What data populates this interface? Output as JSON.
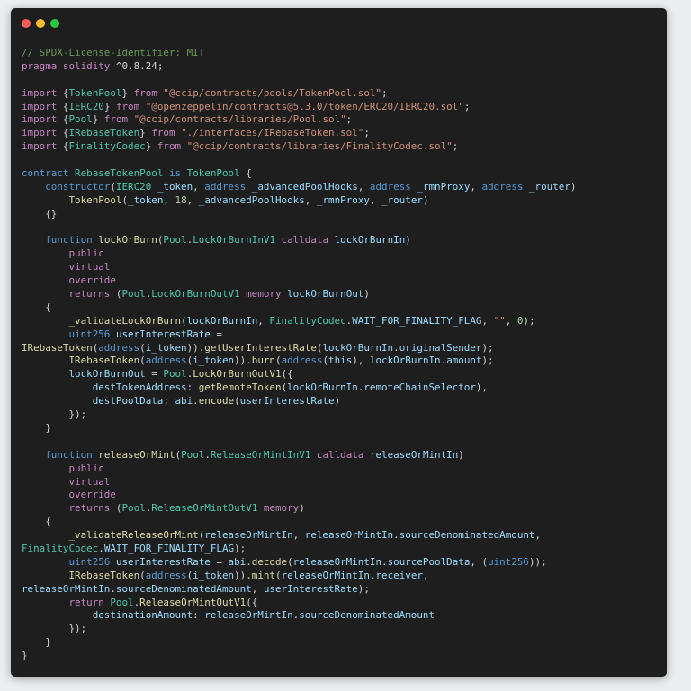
{
  "window": {
    "traffic_lights": [
      "close",
      "minimize",
      "maximize"
    ]
  },
  "theme": {
    "background": "#1e1e1e",
    "comment": "#6a9955",
    "keyword": "#c586c0",
    "declaration": "#569cd6",
    "type": "#4ec9b0",
    "string": "#ce9178",
    "number": "#b5cea8",
    "function": "#dcdcaa",
    "variable": "#9cdcfe",
    "text": "#d4d4d4"
  },
  "code": {
    "language": "solidity",
    "lines": [
      [
        [
          "c",
          "// SPDX-License-Identifier: MIT"
        ]
      ],
      [
        [
          "k",
          "pragma"
        ],
        [
          "p",
          " "
        ],
        [
          "k",
          "solidity"
        ],
        [
          "p",
          " ^0.8.24;"
        ]
      ],
      [],
      [
        [
          "k",
          "import"
        ],
        [
          "p",
          " {"
        ],
        [
          "t",
          "TokenPool"
        ],
        [
          "p",
          "} "
        ],
        [
          "k",
          "from"
        ],
        [
          "p",
          " "
        ],
        [
          "s",
          "\"@ccip/contracts/pools/TokenPool.sol\""
        ],
        [
          "p",
          ";"
        ]
      ],
      [
        [
          "k",
          "import"
        ],
        [
          "p",
          " {"
        ],
        [
          "t",
          "IERC20"
        ],
        [
          "p",
          "} "
        ],
        [
          "k",
          "from"
        ],
        [
          "p",
          " "
        ],
        [
          "s",
          "\"@openzeppelin/contracts@5.3.0/token/ERC20/IERC20.sol\""
        ],
        [
          "p",
          ";"
        ]
      ],
      [
        [
          "k",
          "import"
        ],
        [
          "p",
          " {"
        ],
        [
          "t",
          "Pool"
        ],
        [
          "p",
          "} "
        ],
        [
          "k",
          "from"
        ],
        [
          "p",
          " "
        ],
        [
          "s",
          "\"@ccip/contracts/libraries/Pool.sol\""
        ],
        [
          "p",
          ";"
        ]
      ],
      [
        [
          "k",
          "import"
        ],
        [
          "p",
          " {"
        ],
        [
          "t",
          "IRebaseToken"
        ],
        [
          "p",
          "} "
        ],
        [
          "k",
          "from"
        ],
        [
          "p",
          " "
        ],
        [
          "s",
          "\"./interfaces/IRebaseToken.sol\""
        ],
        [
          "p",
          ";"
        ]
      ],
      [
        [
          "k",
          "import"
        ],
        [
          "p",
          " {"
        ],
        [
          "t",
          "FinalityCodec"
        ],
        [
          "p",
          "} "
        ],
        [
          "k",
          "from"
        ],
        [
          "p",
          " "
        ],
        [
          "s",
          "\"@ccip/contracts/libraries/FinalityCodec.sol\""
        ],
        [
          "p",
          ";"
        ]
      ],
      [],
      [
        [
          "d",
          "contract"
        ],
        [
          "p",
          " "
        ],
        [
          "t",
          "RebaseTokenPool"
        ],
        [
          "p",
          " "
        ],
        [
          "d",
          "is"
        ],
        [
          "p",
          " "
        ],
        [
          "t",
          "TokenPool"
        ],
        [
          "p",
          " {"
        ]
      ],
      [
        [
          "p",
          "    "
        ],
        [
          "d",
          "constructor"
        ],
        [
          "p",
          "("
        ],
        [
          "t",
          "IERC20"
        ],
        [
          "p",
          " "
        ],
        [
          "v",
          "_token"
        ],
        [
          "p",
          ", "
        ],
        [
          "d",
          "address"
        ],
        [
          "p",
          " "
        ],
        [
          "v",
          "_advancedPoolHooks"
        ],
        [
          "p",
          ", "
        ],
        [
          "d",
          "address"
        ],
        [
          "p",
          " "
        ],
        [
          "v",
          "_rmnProxy"
        ],
        [
          "p",
          ", "
        ],
        [
          "d",
          "address"
        ],
        [
          "p",
          " "
        ],
        [
          "v",
          "_router"
        ],
        [
          "p",
          ")"
        ]
      ],
      [
        [
          "p",
          "        "
        ],
        [
          "f",
          "TokenPool"
        ],
        [
          "p",
          "("
        ],
        [
          "v",
          "_token"
        ],
        [
          "p",
          ", "
        ],
        [
          "n",
          "18"
        ],
        [
          "p",
          ", "
        ],
        [
          "v",
          "_advancedPoolHooks"
        ],
        [
          "p",
          ", "
        ],
        [
          "v",
          "_rmnProxy"
        ],
        [
          "p",
          ", "
        ],
        [
          "v",
          "_router"
        ],
        [
          "p",
          ")"
        ]
      ],
      [
        [
          "p",
          "    {}"
        ]
      ],
      [],
      [
        [
          "p",
          "    "
        ],
        [
          "d",
          "function"
        ],
        [
          "p",
          " "
        ],
        [
          "f",
          "lockOrBurn"
        ],
        [
          "p",
          "("
        ],
        [
          "t",
          "Pool"
        ],
        [
          "p",
          "."
        ],
        [
          "t",
          "LockOrBurnInV1"
        ],
        [
          "p",
          " "
        ],
        [
          "k",
          "calldata"
        ],
        [
          "p",
          " "
        ],
        [
          "v",
          "lockOrBurnIn"
        ],
        [
          "p",
          ")"
        ]
      ],
      [
        [
          "p",
          "        "
        ],
        [
          "k",
          "public"
        ]
      ],
      [
        [
          "p",
          "        "
        ],
        [
          "k",
          "virtual"
        ]
      ],
      [
        [
          "p",
          "        "
        ],
        [
          "k",
          "override"
        ]
      ],
      [
        [
          "p",
          "        "
        ],
        [
          "k",
          "returns"
        ],
        [
          "p",
          " ("
        ],
        [
          "t",
          "Pool"
        ],
        [
          "p",
          "."
        ],
        [
          "t",
          "LockOrBurnOutV1"
        ],
        [
          "p",
          " "
        ],
        [
          "k",
          "memory"
        ],
        [
          "p",
          " "
        ],
        [
          "v",
          "lockOrBurnOut"
        ],
        [
          "p",
          ")"
        ]
      ],
      [
        [
          "p",
          "    {"
        ]
      ],
      [
        [
          "p",
          "        "
        ],
        [
          "f",
          "_validateLockOrBurn"
        ],
        [
          "p",
          "("
        ],
        [
          "v",
          "lockOrBurnIn"
        ],
        [
          "p",
          ", "
        ],
        [
          "t",
          "FinalityCodec"
        ],
        [
          "p",
          "."
        ],
        [
          "v",
          "WAIT_FOR_FINALITY_FLAG"
        ],
        [
          "p",
          ", "
        ],
        [
          "s",
          "\"\""
        ],
        [
          "p",
          ", "
        ],
        [
          "n",
          "0"
        ],
        [
          "p",
          ");"
        ]
      ],
      [
        [
          "p",
          "        "
        ],
        [
          "d",
          "uint256"
        ],
        [
          "p",
          " "
        ],
        [
          "v",
          "userInterestRate"
        ],
        [
          "p",
          " ="
        ]
      ],
      [
        [
          "f",
          "IRebaseToken"
        ],
        [
          "p",
          "("
        ],
        [
          "d",
          "address"
        ],
        [
          "p",
          "("
        ],
        [
          "v",
          "i_token"
        ],
        [
          "p",
          "))."
        ],
        [
          "f",
          "getUserInterestRate"
        ],
        [
          "p",
          "("
        ],
        [
          "v",
          "lockOrBurnIn"
        ],
        [
          "p",
          "."
        ],
        [
          "v",
          "originalSender"
        ],
        [
          "p",
          ");"
        ]
      ],
      [
        [
          "p",
          "        "
        ],
        [
          "f",
          "IRebaseToken"
        ],
        [
          "p",
          "("
        ],
        [
          "d",
          "address"
        ],
        [
          "p",
          "("
        ],
        [
          "v",
          "i_token"
        ],
        [
          "p",
          "))."
        ],
        [
          "f",
          "burn"
        ],
        [
          "p",
          "("
        ],
        [
          "d",
          "address"
        ],
        [
          "p",
          "("
        ],
        [
          "v",
          "this"
        ],
        [
          "p",
          "), "
        ],
        [
          "v",
          "lockOrBurnIn"
        ],
        [
          "p",
          "."
        ],
        [
          "v",
          "amount"
        ],
        [
          "p",
          ");"
        ]
      ],
      [
        [
          "p",
          "        "
        ],
        [
          "v",
          "lockOrBurnOut"
        ],
        [
          "p",
          " = "
        ],
        [
          "t",
          "Pool"
        ],
        [
          "p",
          "."
        ],
        [
          "f",
          "LockOrBurnOutV1"
        ],
        [
          "p",
          "({"
        ]
      ],
      [
        [
          "p",
          "            "
        ],
        [
          "v",
          "destTokenAddress"
        ],
        [
          "p",
          ": "
        ],
        [
          "f",
          "getRemoteToken"
        ],
        [
          "p",
          "("
        ],
        [
          "v",
          "lockOrBurnIn"
        ],
        [
          "p",
          "."
        ],
        [
          "v",
          "remoteChainSelector"
        ],
        [
          "p",
          "),"
        ]
      ],
      [
        [
          "p",
          "            "
        ],
        [
          "v",
          "destPoolData"
        ],
        [
          "p",
          ": "
        ],
        [
          "v",
          "abi"
        ],
        [
          "p",
          "."
        ],
        [
          "f",
          "encode"
        ],
        [
          "p",
          "("
        ],
        [
          "v",
          "userInterestRate"
        ],
        [
          "p",
          ")"
        ]
      ],
      [
        [
          "p",
          "        });"
        ]
      ],
      [
        [
          "p",
          "    }"
        ]
      ],
      [],
      [
        [
          "p",
          "    "
        ],
        [
          "d",
          "function"
        ],
        [
          "p",
          " "
        ],
        [
          "f",
          "releaseOrMint"
        ],
        [
          "p",
          "("
        ],
        [
          "t",
          "Pool"
        ],
        [
          "p",
          "."
        ],
        [
          "t",
          "ReleaseOrMintInV1"
        ],
        [
          "p",
          " "
        ],
        [
          "k",
          "calldata"
        ],
        [
          "p",
          " "
        ],
        [
          "v",
          "releaseOrMintIn"
        ],
        [
          "p",
          ")"
        ]
      ],
      [
        [
          "p",
          "        "
        ],
        [
          "k",
          "public"
        ]
      ],
      [
        [
          "p",
          "        "
        ],
        [
          "k",
          "virtual"
        ]
      ],
      [
        [
          "p",
          "        "
        ],
        [
          "k",
          "override"
        ]
      ],
      [
        [
          "p",
          "        "
        ],
        [
          "k",
          "returns"
        ],
        [
          "p",
          " ("
        ],
        [
          "t",
          "Pool"
        ],
        [
          "p",
          "."
        ],
        [
          "t",
          "ReleaseOrMintOutV1"
        ],
        [
          "p",
          " "
        ],
        [
          "k",
          "memory"
        ],
        [
          "p",
          ")"
        ]
      ],
      [
        [
          "p",
          "    {"
        ]
      ],
      [
        [
          "p",
          "        "
        ],
        [
          "f",
          "_validateReleaseOrMint"
        ],
        [
          "p",
          "("
        ],
        [
          "v",
          "releaseOrMintIn"
        ],
        [
          "p",
          ", "
        ],
        [
          "v",
          "releaseOrMintIn"
        ],
        [
          "p",
          "."
        ],
        [
          "v",
          "sourceDenominatedAmount"
        ],
        [
          "p",
          ","
        ]
      ],
      [
        [
          "t",
          "FinalityCodec"
        ],
        [
          "p",
          "."
        ],
        [
          "v",
          "WAIT_FOR_FINALITY_FLAG"
        ],
        [
          "p",
          ");"
        ]
      ],
      [
        [
          "p",
          "        "
        ],
        [
          "d",
          "uint256"
        ],
        [
          "p",
          " "
        ],
        [
          "v",
          "userInterestRate"
        ],
        [
          "p",
          " = "
        ],
        [
          "v",
          "abi"
        ],
        [
          "p",
          "."
        ],
        [
          "f",
          "decode"
        ],
        [
          "p",
          "("
        ],
        [
          "v",
          "releaseOrMintIn"
        ],
        [
          "p",
          "."
        ],
        [
          "v",
          "sourcePoolData"
        ],
        [
          "p",
          ", ("
        ],
        [
          "d",
          "uint256"
        ],
        [
          "p",
          "));"
        ]
      ],
      [
        [
          "p",
          "        "
        ],
        [
          "f",
          "IRebaseToken"
        ],
        [
          "p",
          "("
        ],
        [
          "d",
          "address"
        ],
        [
          "p",
          "("
        ],
        [
          "v",
          "i_token"
        ],
        [
          "p",
          "))."
        ],
        [
          "f",
          "mint"
        ],
        [
          "p",
          "("
        ],
        [
          "v",
          "releaseOrMintIn"
        ],
        [
          "p",
          "."
        ],
        [
          "v",
          "receiver"
        ],
        [
          "p",
          ","
        ]
      ],
      [
        [
          "v",
          "releaseOrMintIn"
        ],
        [
          "p",
          "."
        ],
        [
          "v",
          "sourceDenominatedAmount"
        ],
        [
          "p",
          ", "
        ],
        [
          "v",
          "userInterestRate"
        ],
        [
          "p",
          ");"
        ]
      ],
      [
        [
          "p",
          "        "
        ],
        [
          "k",
          "return"
        ],
        [
          "p",
          " "
        ],
        [
          "t",
          "Pool"
        ],
        [
          "p",
          "."
        ],
        [
          "f",
          "ReleaseOrMintOutV1"
        ],
        [
          "p",
          "({"
        ]
      ],
      [
        [
          "p",
          "            "
        ],
        [
          "v",
          "destinationAmount"
        ],
        [
          "p",
          ": "
        ],
        [
          "v",
          "releaseOrMintIn"
        ],
        [
          "p",
          "."
        ],
        [
          "v",
          "sourceDenominatedAmount"
        ]
      ],
      [
        [
          "p",
          "        });"
        ]
      ],
      [
        [
          "p",
          "    }"
        ]
      ],
      [
        [
          "p",
          "}"
        ]
      ]
    ],
    "cursor_line": 46
  }
}
